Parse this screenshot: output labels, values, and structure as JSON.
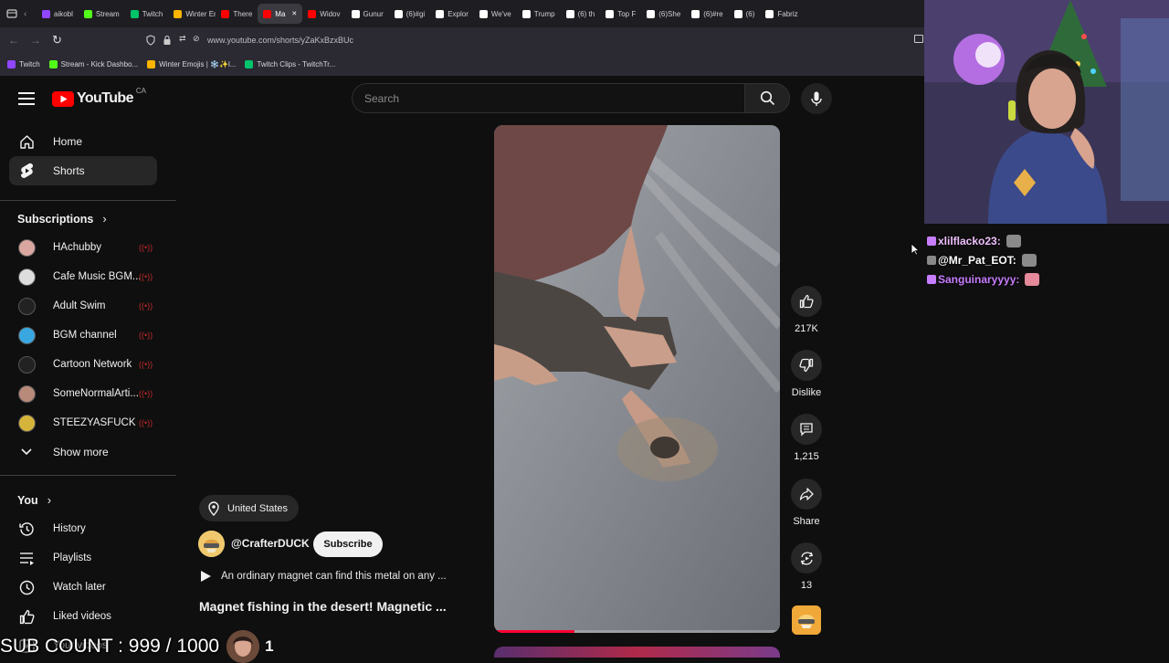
{
  "browser": {
    "tabs": [
      {
        "label": "aikobl",
        "color": "#9146ff"
      },
      {
        "label": "Stream",
        "color": "#53fc18"
      },
      {
        "label": "Twitch",
        "color": "#00c46a"
      },
      {
        "label": "Winter Em",
        "color": "#ffb400"
      },
      {
        "label": "There",
        "color": "#ff0000"
      },
      {
        "label": "Ma",
        "color": "#ff0000",
        "active": true
      },
      {
        "label": "Widov",
        "color": "#ff0000"
      },
      {
        "label": "Gunur",
        "color": "#ffffff"
      },
      {
        "label": "(6)#gi",
        "color": "#ffffff"
      },
      {
        "label": "Explor",
        "color": "#ffffff"
      },
      {
        "label": "We've",
        "color": "#ffffff"
      },
      {
        "label": "Trump",
        "color": "#ffffff"
      },
      {
        "label": "(6) th",
        "color": "#ffffff"
      },
      {
        "label": "Top F",
        "color": "#ffffff"
      },
      {
        "label": "(6)She",
        "color": "#ffffff"
      },
      {
        "label": "(6)#re",
        "color": "#ffffff"
      },
      {
        "label": "(6)",
        "color": "#ffffff"
      },
      {
        "label": "Fabriz",
        "color": "#ffffff"
      }
    ],
    "active_close": "✕",
    "url": "www.youtube.com/shorts/yZaKxBzxBUc",
    "bookmarks": [
      {
        "label": "Twitch",
        "color": "#9146ff"
      },
      {
        "label": "Stream - Kick Dashbo...",
        "color": "#53fc18"
      },
      {
        "label": "Winter Emojis | ❄️✨l...",
        "color": "#ffb400"
      },
      {
        "label": "Twitch Clips - TwitchTr...",
        "color": "#00c46a"
      }
    ]
  },
  "youtube": {
    "logo_text": "YouTube",
    "country": "CA",
    "search_placeholder": "Search",
    "nav": [
      {
        "label": "Home",
        "icon": "home-icon"
      },
      {
        "label": "Shorts",
        "icon": "shorts-icon",
        "active": true
      }
    ],
    "subscriptions_title": "Subscriptions",
    "subscriptions": [
      {
        "label": "HAchubby",
        "color": "#d9a6a0"
      },
      {
        "label": "Cafe Music BGM...",
        "color": "#dddddd"
      },
      {
        "label": "Adult Swim",
        "color": "#222222"
      },
      {
        "label": "BGM channel",
        "color": "#3aa8e0"
      },
      {
        "label": "Cartoon Network",
        "color": "#222222"
      },
      {
        "label": "SomeNormalArti...",
        "color": "#b88a7a"
      },
      {
        "label": "STEEZYASFUCK",
        "color": "#d6b33a"
      }
    ],
    "live_indicator": "((•))",
    "show_more": "Show more",
    "you_title": "You",
    "you_items": [
      {
        "label": "History",
        "icon": "history-icon"
      },
      {
        "label": "Playlists",
        "icon": "playlists-icon"
      },
      {
        "label": "Watch later",
        "icon": "watch-later-icon"
      },
      {
        "label": "Liked videos",
        "icon": "liked-videos-icon"
      },
      {
        "label": "Your videos",
        "icon": "your-videos-icon"
      }
    ],
    "short": {
      "location": "United States",
      "channel": "@CrafterDUCK",
      "subscribe_label": "Subscribe",
      "description": "An ordinary magnet can find this metal on any ...",
      "title": "Magnet fishing in the desert! Magnetic ...",
      "progress": 0.28,
      "likes": "217K",
      "dislike_label": "Dislike",
      "comments": "1,215",
      "share_label": "Share",
      "remix_count": "13"
    }
  },
  "chat": {
    "messages": [
      {
        "user": "xlilflacko23:",
        "color": "#f0c0ff"
      },
      {
        "user": "@Mr_Pat_EOT:",
        "color": "#ffffff"
      },
      {
        "user": "Sanguinaryyyy:",
        "color": "#c77dff"
      }
    ]
  },
  "overlay": {
    "sub_count": "SUB COUNT : 999 / 1000",
    "badge": "1"
  }
}
